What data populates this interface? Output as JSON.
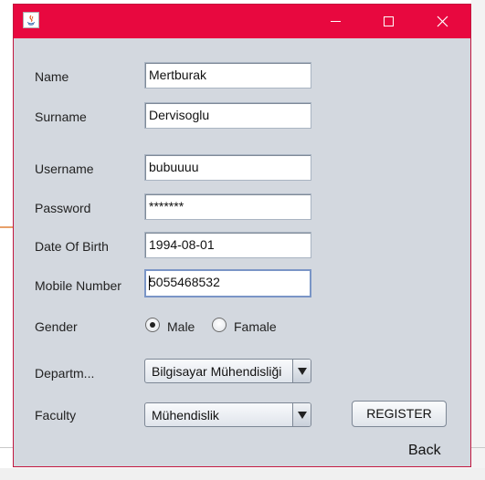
{
  "window": {
    "title": "",
    "titlebar_color": "#e8083f",
    "body_color": "#d3d8df",
    "icons": [
      "java-app-icon",
      "minimize-icon",
      "maximize-icon",
      "close-icon"
    ]
  },
  "form": {
    "name_label": "Name",
    "name_value": "Mertburak",
    "surname_label": "Surname",
    "surname_value": "Dervisoglu",
    "username_label": "Username",
    "username_value": "bubuuuu",
    "password_label": "Password",
    "password_value": "*******",
    "dob_label": "Date Of Birth",
    "dob_value": "1994-08-01",
    "mobile_label": "Mobile Number",
    "mobile_value": "5055468532",
    "gender_label": "Gender",
    "gender_options": [
      "Male",
      "Famale"
    ],
    "gender_selected": "Male",
    "department_label": "Departm...",
    "department_selected": "Bilgisayar Mühendisliği",
    "faculty_label": "Faculty",
    "faculty_selected": "Mühendislik",
    "register_label": "REGISTER",
    "back_label": "Back"
  }
}
